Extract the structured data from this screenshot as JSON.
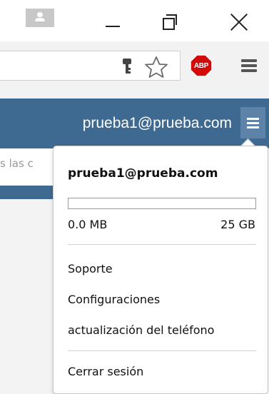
{
  "window": {
    "controls": [
      "minimize",
      "restore",
      "close"
    ]
  },
  "toolbar": {
    "icons": [
      "key-icon",
      "star-icon",
      "adblock-plus-icon",
      "chrome-menu-icon"
    ],
    "abp_label": "ABP"
  },
  "header": {
    "account_email": "prueba1@prueba.com",
    "menu_icon": "hamburger-icon"
  },
  "background": {
    "search_fragment": "s las c"
  },
  "dropdown": {
    "email": "prueba1@prueba.com",
    "storage": {
      "used": "0.0 MB",
      "total": "25 GB",
      "fraction": 0.0
    },
    "items": [
      {
        "label": "Soporte"
      },
      {
        "label": "Configuraciones"
      },
      {
        "label": "actualización del teléfono"
      }
    ],
    "logout": "Cerrar sesión"
  },
  "colors": {
    "header_bg": "#3e6991",
    "hamburger_bg": "#5d84a8",
    "abp_red": "#d20a0a"
  }
}
